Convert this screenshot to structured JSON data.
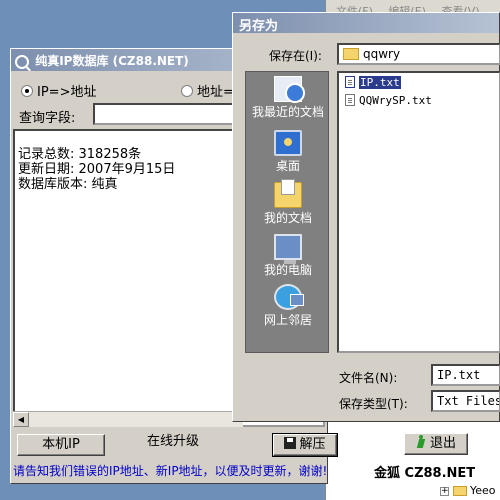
{
  "background_explorer": {
    "menu": [
      "文件(F)",
      "编辑(E)",
      "查看(V)"
    ],
    "tree_items": [
      "",
      "Yeeo"
    ]
  },
  "cz_window": {
    "title": "纯真IP数据库 (CZ88.NET)",
    "radio_ip": "IP=>地址",
    "radio_addr": "地址=",
    "query_label": "查询字段:",
    "query_value": "",
    "info_lines": [
      "记录总数: 318258条",
      "更新日期: 2007年9月15日",
      "数据库版本: 纯真"
    ],
    "buttons": {
      "local_ip": "本机IP",
      "online_upgrade": "在线升级",
      "extract": "解压",
      "exit": "退出"
    },
    "status_text": "请告知我们错误的IP地址、新IP地址，以便及时更新，谢谢!",
    "brand": "金狐 CZ88.NET"
  },
  "save_dialog": {
    "title": "另存为",
    "save_in_label": "保存在(I):",
    "save_in_value": "qqwry",
    "places": [
      {
        "label": "我最近的文档",
        "icon": "recent-documents-icon"
      },
      {
        "label": "桌面",
        "icon": "desktop-icon"
      },
      {
        "label": "我的文档",
        "icon": "my-documents-icon"
      },
      {
        "label": "我的电脑",
        "icon": "my-computer-icon"
      },
      {
        "label": "网上邻居",
        "icon": "network-places-icon"
      }
    ],
    "files": [
      {
        "name": "IP.txt",
        "selected": true
      },
      {
        "name": "QQWrySP.txt",
        "selected": false
      }
    ],
    "filename_label": "文件名(N):",
    "filename_value": "IP.txt",
    "filetype_label": "保存类型(T):",
    "filetype_value": "Txt Files"
  }
}
